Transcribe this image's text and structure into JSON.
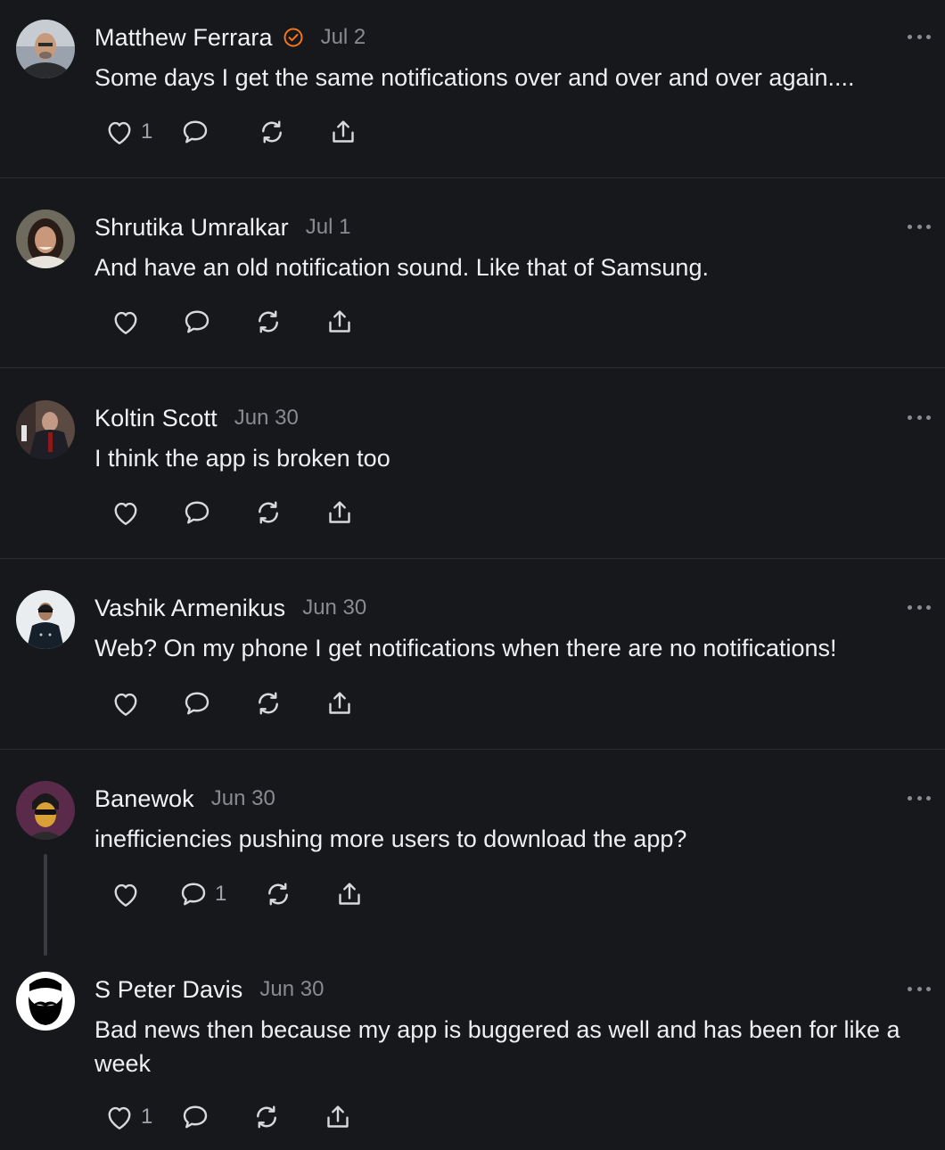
{
  "posts": [
    {
      "name": "Matthew Ferrara",
      "verified": true,
      "date": "Jul 2",
      "text": "Some days I get the same notifications over and over and over again....",
      "likes": "1",
      "replies": ""
    },
    {
      "name": "Shrutika Umralkar",
      "verified": false,
      "date": "Jul 1",
      "text": "And have an old notification sound. Like that of Samsung.",
      "likes": "",
      "replies": ""
    },
    {
      "name": "Koltin Scott",
      "verified": false,
      "date": "Jun 30",
      "text": "I think the app is broken too",
      "likes": "",
      "replies": ""
    },
    {
      "name": "Vashik Armenikus",
      "verified": false,
      "date": "Jun 30",
      "text": "Web? On my phone I get notifications when there are no notifications!",
      "likes": "",
      "replies": ""
    },
    {
      "name": "Banewok",
      "verified": false,
      "date": "Jun 30",
      "text": "inefficiencies pushing more users to download the app?",
      "likes": "",
      "replies": "1"
    },
    {
      "name": "S Peter Davis",
      "verified": false,
      "date": "Jun 30",
      "text": "Bad news then because my app is buggered as well and has been for like a week",
      "likes": "1",
      "replies": ""
    }
  ],
  "icons": {
    "like": "heart-icon",
    "reply": "comment-icon",
    "repost": "repost-icon",
    "share": "share-icon",
    "more": "more-icon",
    "verified": "verified-badge-icon"
  },
  "colors": {
    "background": "#17181c",
    "verified_badge": "#f4751b",
    "muted_text": "#8a8b92"
  }
}
